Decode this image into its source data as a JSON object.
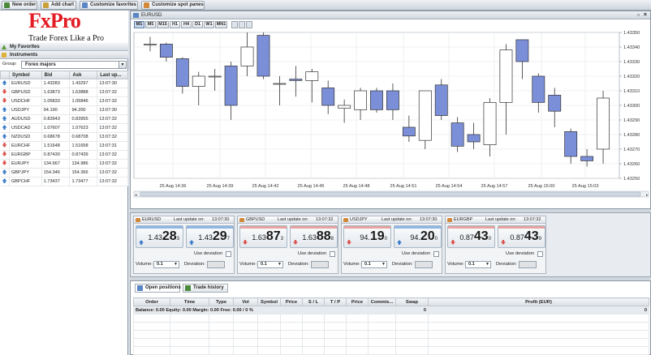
{
  "toolbar": {
    "buttons": [
      {
        "label": "New order",
        "icon": "new-order-icon"
      },
      {
        "label": "Add chart",
        "icon": "add-chart-icon"
      },
      {
        "label": "Customize favorites",
        "icon": "favorites-icon"
      },
      {
        "label": "Customize spot panes",
        "icon": "spot-panes-icon"
      }
    ]
  },
  "brand": {
    "name": "FxPro",
    "tagline": "Trade Forex Like a Pro",
    "color": "#e31b23"
  },
  "sidebar": {
    "favorites_label": "My Favorites",
    "instruments_label": "Instruments",
    "group_label": "Group:",
    "group_value": "Forex majors",
    "columns": [
      "Symbol",
      "Bid",
      "Ask",
      "Last up..."
    ],
    "rows": [
      {
        "dir": "up",
        "symbol": "EURUSD",
        "bid": "1.43283",
        "ask": "1.43297",
        "time": "13:07:30"
      },
      {
        "dir": "down",
        "symbol": "GBPUSD",
        "bid": "1.63873",
        "ask": "1.63888",
        "time": "13:07:32"
      },
      {
        "dir": "down",
        "symbol": "USDCHF",
        "bid": "1.05833",
        "ask": "1.05846",
        "time": "13:07:32"
      },
      {
        "dir": "up",
        "symbol": "USDJPY",
        "bid": "94.190",
        "ask": "94.200",
        "time": "13:07:30"
      },
      {
        "dir": "up",
        "symbol": "AUDUSD",
        "bid": "0.83943",
        "ask": "0.83955",
        "time": "13:07:32"
      },
      {
        "dir": "up",
        "symbol": "USDCAD",
        "bid": "1.07607",
        "ask": "1.07623",
        "time": "13:07:32"
      },
      {
        "dir": "up",
        "symbol": "NZDUSD",
        "bid": "0.68678",
        "ask": "0.68708",
        "time": "13:07:32"
      },
      {
        "dir": "down",
        "symbol": "EURCHF",
        "bid": "1.51648",
        "ask": "1.51658",
        "time": "13:07:31"
      },
      {
        "dir": "down",
        "symbol": "EURGBP",
        "bid": "0.87430",
        "ask": "0.87439",
        "time": "13:07:32"
      },
      {
        "dir": "down",
        "symbol": "EURJPY",
        "bid": "134.967",
        "ask": "134.986",
        "time": "13:07:32"
      },
      {
        "dir": "up",
        "symbol": "GBPJPY",
        "bid": "154.346",
        "ask": "154.366",
        "time": "13:07:32"
      },
      {
        "dir": "up",
        "symbol": "GBPCHF",
        "bid": "1.73437",
        "ask": "1.73477",
        "time": "13:07:32"
      }
    ]
  },
  "chart_window": {
    "title": "EURUSD",
    "timeframes": [
      "M1",
      "M5",
      "M15",
      "H1",
      "H4",
      "D1",
      "W1",
      "MN1"
    ],
    "active_timeframe": "M1"
  },
  "chart_data": {
    "type": "candlestick",
    "symbol": "EURUSD",
    "ylim": [
      1.4325,
      1.4335
    ],
    "y_ticks": [
      "1.43250",
      "1.43260",
      "1.43270",
      "1.43280",
      "1.43290",
      "1.43300",
      "1.43310",
      "1.43320",
      "1.43330",
      "1.43340",
      "1.43350"
    ],
    "x_ticks": [
      "25 Aug 14:36",
      "25 Aug 14:39",
      "25 Aug 14:42",
      "25 Aug 14:45",
      "25 Aug 14:48",
      "25 Aug 14:51",
      "25 Aug 14:54",
      "25 Aug 14:57",
      "25 Aug 15:00",
      "25 Aug 15:03"
    ],
    "up_color": "#ffffff",
    "down_color": "#7b8fd8",
    "candles": [
      {
        "o": 1.43342,
        "h": 1.43347,
        "l": 1.43337,
        "c": 1.43342
      },
      {
        "o": 1.43342,
        "h": 1.43343,
        "l": 1.4333,
        "c": 1.43333
      },
      {
        "o": 1.43332,
        "h": 1.43333,
        "l": 1.43308,
        "c": 1.43313
      },
      {
        "o": 1.43313,
        "h": 1.43323,
        "l": 1.433,
        "c": 1.4332
      },
      {
        "o": 1.4332,
        "h": 1.43325,
        "l": 1.4331,
        "c": 1.4332
      },
      {
        "o": 1.43327,
        "h": 1.4333,
        "l": 1.4329,
        "c": 1.433
      },
      {
        "o": 1.43327,
        "h": 1.4335,
        "l": 1.4332,
        "c": 1.4334
      },
      {
        "o": 1.43348,
        "h": 1.4335,
        "l": 1.43318,
        "c": 1.4332
      },
      {
        "o": 1.43315,
        "h": 1.4332,
        "l": 1.433,
        "c": 1.43315
      },
      {
        "o": 1.43318,
        "h": 1.43327,
        "l": 1.43306,
        "c": 1.43317
      },
      {
        "o": 1.43317,
        "h": 1.43325,
        "l": 1.43302,
        "c": 1.43323
      },
      {
        "o": 1.43312,
        "h": 1.43317,
        "l": 1.43294,
        "c": 1.433
      },
      {
        "o": 1.43298,
        "h": 1.43304,
        "l": 1.43288,
        "c": 1.433
      },
      {
        "o": 1.43297,
        "h": 1.43312,
        "l": 1.4329,
        "c": 1.4331
      },
      {
        "o": 1.4331,
        "h": 1.43312,
        "l": 1.43295,
        "c": 1.43297
      },
      {
        "o": 1.4331,
        "h": 1.43315,
        "l": 1.4329,
        "c": 1.43297
      },
      {
        "o": 1.43285,
        "h": 1.43293,
        "l": 1.43275,
        "c": 1.43279
      },
      {
        "o": 1.43276,
        "h": 1.43308,
        "l": 1.4327,
        "c": 1.4331
      },
      {
        "o": 1.43314,
        "h": 1.43318,
        "l": 1.4329,
        "c": 1.43293
      },
      {
        "o": 1.43288,
        "h": 1.43292,
        "l": 1.43268,
        "c": 1.43272
      },
      {
        "o": 1.4328,
        "h": 1.43288,
        "l": 1.4327,
        "c": 1.43275
      },
      {
        "o": 1.43273,
        "h": 1.43305,
        "l": 1.43265,
        "c": 1.43302
      },
      {
        "o": 1.43302,
        "h": 1.43342,
        "l": 1.4328,
        "c": 1.43338
      },
      {
        "o": 1.43345,
        "h": 1.43345,
        "l": 1.43318,
        "c": 1.4333
      },
      {
        "o": 1.4332,
        "h": 1.43322,
        "l": 1.43295,
        "c": 1.43302
      },
      {
        "o": 1.43307,
        "h": 1.43312,
        "l": 1.43285,
        "c": 1.43296
      },
      {
        "o": 1.43282,
        "h": 1.43284,
        "l": 1.4326,
        "c": 1.43265
      },
      {
        "o": 1.43265,
        "h": 1.4327,
        "l": 1.43258,
        "c": 1.43262
      },
      {
        "o": 1.4327,
        "h": 1.4331,
        "l": 1.4326,
        "c": 1.43305
      }
    ]
  },
  "spot_panes": {
    "last_update_label": "Last update on:",
    "use_deviation_label": "Use deviation",
    "volume_label": "Volume:",
    "deviation_label": "Deviation:",
    "panes": [
      {
        "symbol": "EURUSD",
        "time": "13:07:30",
        "bid_prefix": "1.43",
        "bid_big": "28",
        "bid_pip": "3",
        "bid_dir": "up",
        "ask_prefix": "1.43",
        "ask_big": "29",
        "ask_pip": "7",
        "ask_dir": "up",
        "volume": "0.1"
      },
      {
        "symbol": "GBPUSD",
        "time": "13:07:32",
        "bid_prefix": "1.63",
        "bid_big": "87",
        "bid_pip": "3",
        "bid_dir": "down",
        "ask_prefix": "1.63",
        "ask_big": "88",
        "ask_pip": "8",
        "ask_dir": "down",
        "volume": "0.1"
      },
      {
        "symbol": "USDJPY",
        "time": "13:07:30",
        "bid_prefix": "94.",
        "bid_big": "19",
        "bid_pip": "0",
        "bid_dir": "down",
        "ask_prefix": "94.",
        "ask_big": "20",
        "ask_pip": "0",
        "ask_dir": "up",
        "volume": "0.1"
      },
      {
        "symbol": "EURGBP",
        "time": "13:07:32",
        "bid_prefix": "0.87",
        "bid_big": "43",
        "bid_pip": "0",
        "bid_dir": "down",
        "ask_prefix": "0.87",
        "ask_big": "43",
        "ask_pip": "9",
        "ask_dir": "down",
        "volume": "0.1"
      }
    ]
  },
  "positions": {
    "tabs": [
      "Open positions",
      "Trade history"
    ],
    "columns": [
      "Order",
      "Time",
      "Type",
      "Vol",
      "Symbol",
      "Price",
      "S / L",
      "T / P",
      "Price",
      "Commis...",
      "Swap",
      "Profit (EUR)"
    ],
    "balance_line": "Balance: 0.00   Equity: 0.00   Margin: 0.00   Free: 0.00 / 0 %",
    "swap_total": "0",
    "profit_total": "0"
  }
}
